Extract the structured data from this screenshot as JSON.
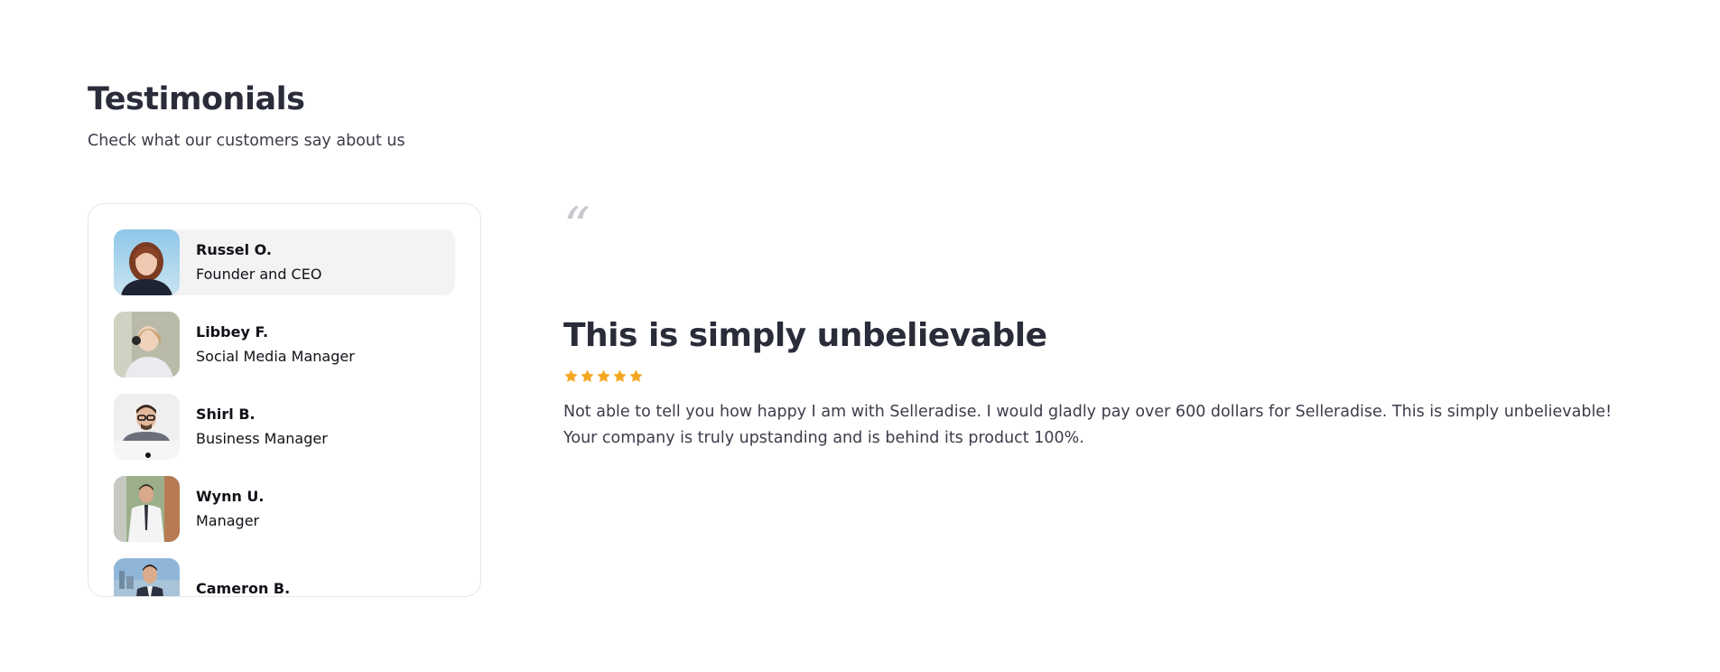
{
  "header": {
    "title": "Testimonials",
    "subtitle": "Check what our customers say about us"
  },
  "people": [
    {
      "name": "Russel O.",
      "role": "Founder and CEO",
      "avatar": "woman-red-hair-avatar",
      "active": true
    },
    {
      "name": "Libbey F.",
      "role": "Social Media Manager",
      "avatar": "woman-headset-avatar",
      "active": false
    },
    {
      "name": "Shirl B.",
      "role": "Business Manager",
      "avatar": "man-glasses-avatar",
      "active": false
    },
    {
      "name": "Wynn U.",
      "role": "Manager",
      "avatar": "man-white-shirt-avatar",
      "active": false
    },
    {
      "name": "Cameron B.",
      "role": "",
      "avatar": "man-suit-city-avatar",
      "active": false
    }
  ],
  "testimonial": {
    "quote_mark": "“",
    "title": "This is simply unbelievable",
    "rating": 5,
    "body": "Not able to tell you how happy I am with Selleradise. I would gladly pay over 600 dollars for Selleradise. This is simply unbelievable! Your company is truly upstanding and is behind its product 100%."
  },
  "colors": {
    "star": "#f5a623",
    "active_row": "#f3f3f4",
    "heading": "#2a2c3a"
  }
}
